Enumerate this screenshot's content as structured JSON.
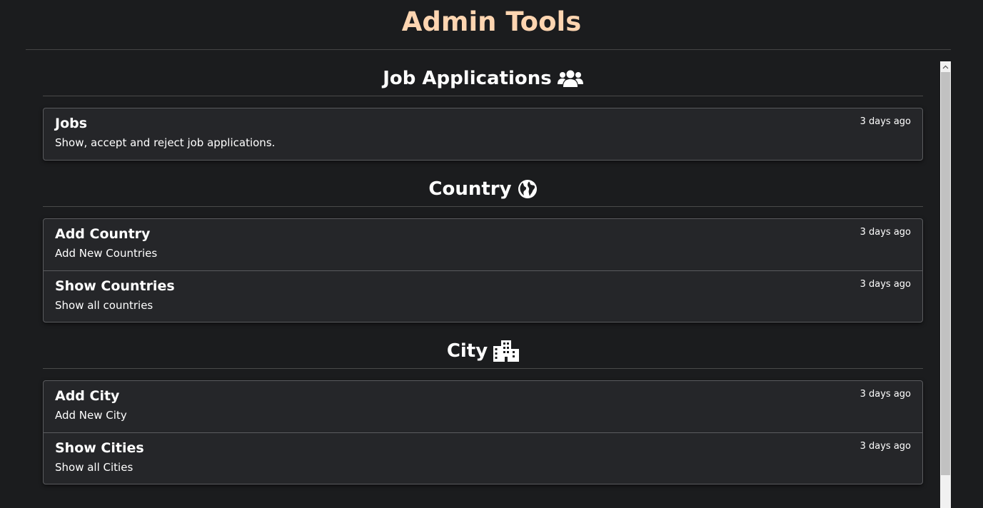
{
  "header": {
    "title": "Admin Tools",
    "title_color": "#fdd5b1"
  },
  "sections": [
    {
      "heading": "Job Applications",
      "icon": "users-icon",
      "items": [
        {
          "title": "Jobs",
          "description": "Show, accept and reject job applications.",
          "time": "3 days ago"
        }
      ]
    },
    {
      "heading": "Country",
      "icon": "globe-icon",
      "items": [
        {
          "title": "Add Country",
          "description": "Add New Countries",
          "time": "3 days ago"
        },
        {
          "title": "Show Countries",
          "description": "Show all countries",
          "time": "3 days ago"
        }
      ]
    },
    {
      "heading": "City",
      "icon": "city-icon",
      "items": [
        {
          "title": "Add City",
          "description": "Add New City",
          "time": "3 days ago"
        },
        {
          "title": "Show Cities",
          "description": "Show all Cities",
          "time": "3 days ago"
        }
      ]
    }
  ],
  "colors": {
    "background": "#1b1c1e",
    "card_background": "#252629",
    "card_border": "#5a5b5e",
    "text": "#ffffff"
  },
  "scrollbar": {
    "position": 0
  }
}
